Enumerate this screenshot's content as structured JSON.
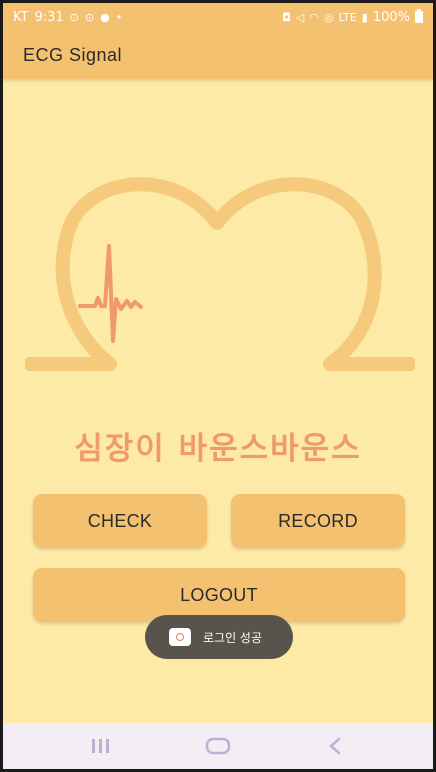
{
  "status_bar": {
    "carrier": "KT",
    "time": "9:31",
    "network": "LTE",
    "battery": "100%"
  },
  "app_bar": {
    "title": "ECG Signal"
  },
  "main": {
    "headline": "심장이 바운스바운스",
    "buttons": {
      "check": "CHECK",
      "record": "RECORD",
      "logout": "LOGOUT"
    }
  },
  "toast": {
    "message": "로그인 성공"
  },
  "colors": {
    "background": "#fdeaa6",
    "accent": "#f3c16f",
    "headline": "#ef9a6a",
    "ecg_line": "#ef9a6a"
  },
  "icons": {
    "nav_recents": "recents-icon",
    "nav_home": "home-icon",
    "nav_back": "back-icon"
  }
}
